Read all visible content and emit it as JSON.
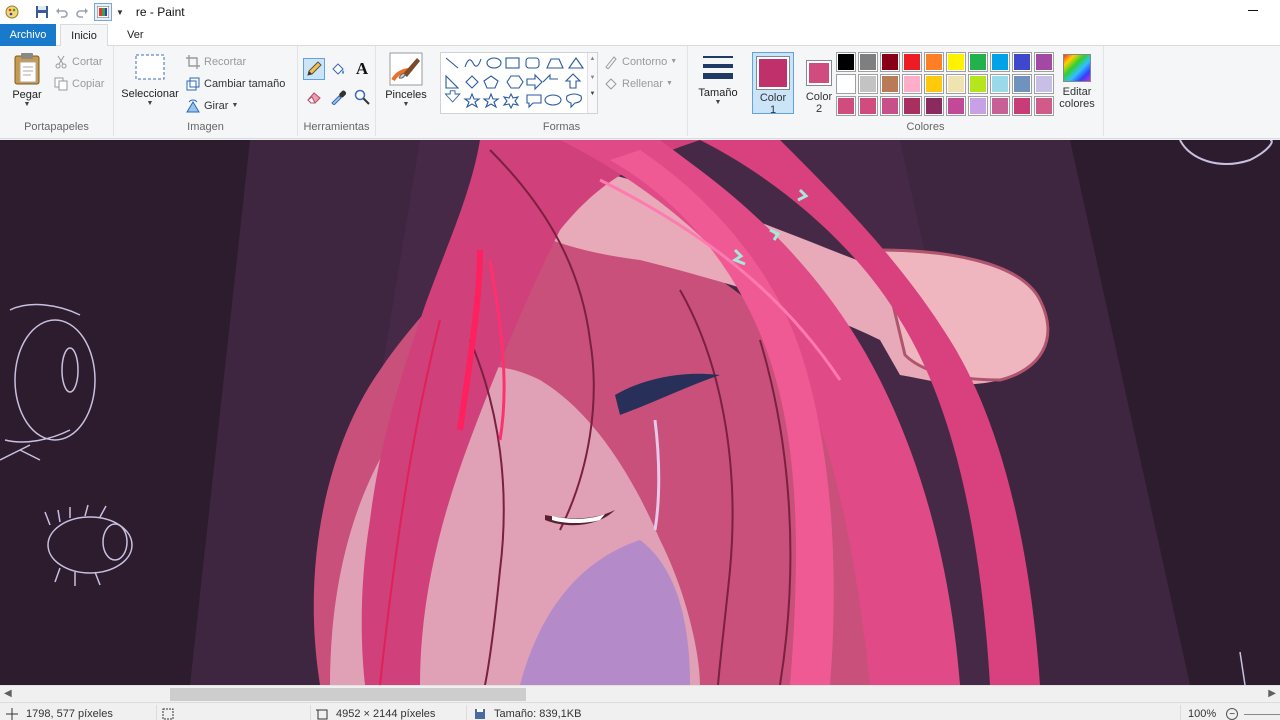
{
  "window": {
    "title": "re - Paint"
  },
  "tabs": {
    "file": "Archivo",
    "home": "Inicio",
    "view": "Ver"
  },
  "clipboard": {
    "paste": "Pegar",
    "cut": "Cortar",
    "copy": "Copiar",
    "group_label": "Portapapeles"
  },
  "image": {
    "select": "Seleccionar",
    "crop": "Recortar",
    "resize": "Cambiar tamaño",
    "rotate": "Girar",
    "group_label": "Imagen"
  },
  "tools": {
    "group_label": "Herramientas",
    "items": [
      "pencil-icon",
      "fill-icon",
      "text-icon",
      "eraser-icon",
      "color-picker-icon",
      "magnifier-icon"
    ]
  },
  "brushes": {
    "label": "Pinceles"
  },
  "shapes": {
    "group_label": "Formas",
    "outline": "Contorno",
    "fill": "Rellenar"
  },
  "size": {
    "label": "Tamaño"
  },
  "colors": {
    "group_label": "Colores",
    "color1_label": "Color 1",
    "color2_label": "Color 2",
    "color1": "#c0306a",
    "color2": "#d04c7e",
    "edit_label": "Editar colores",
    "palette": [
      "#000000",
      "#7f7f7f",
      "#880015",
      "#ed1c24",
      "#ff7f27",
      "#fff200",
      "#22b14c",
      "#00a2e8",
      "#3f48cc",
      "#a349a4",
      "#ffffff",
      "#c3c3c3",
      "#b97a57",
      "#ffaec9",
      "#ffc90e",
      "#efe4b0",
      "#b5e61d",
      "#99d9ea",
      "#7092be",
      "#c8bfe7",
      "#d04c7e",
      "#d04c7e",
      "#c8508a",
      "#a8305e",
      "#8a2a5e",
      "#c24898",
      "#c8a0e6",
      "#c86098",
      "#c83c78",
      "#d05a8a"
    ]
  },
  "status": {
    "cursor": "1798, 577 píxeles",
    "dimensions": "4952 × 2144 píxeles",
    "filesize": "Tamaño: 839,1KB",
    "zoom": "100%"
  }
}
